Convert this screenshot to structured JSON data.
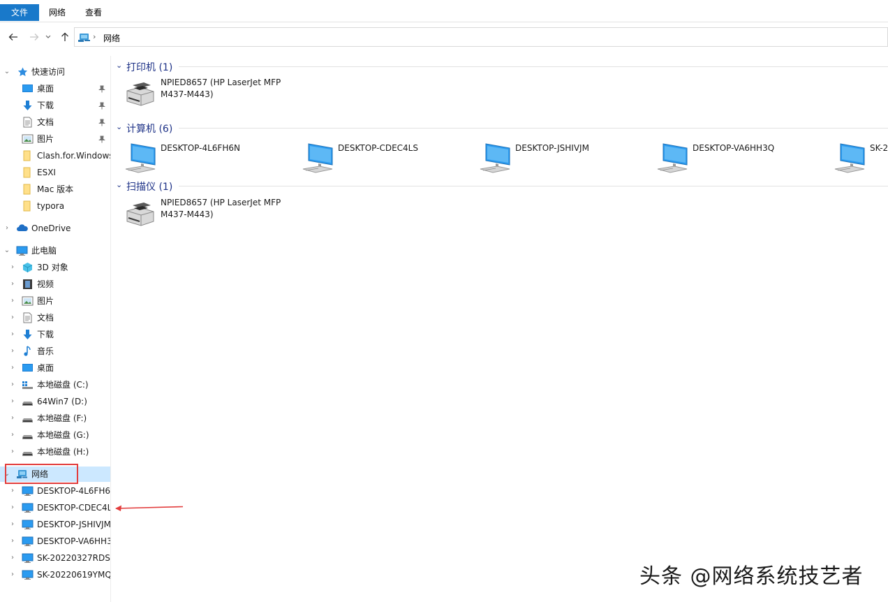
{
  "ribbon": {
    "tabs": [
      "文件",
      "网络",
      "查看"
    ]
  },
  "address": {
    "path": "网络"
  },
  "nav": {
    "quick_access": {
      "label": "快速访问",
      "items": [
        {
          "label": "桌面",
          "icon": "desktop-icon",
          "pinned": true
        },
        {
          "label": "下载",
          "icon": "download-icon",
          "pinned": true
        },
        {
          "label": "文档",
          "icon": "document-icon",
          "pinned": true
        },
        {
          "label": "图片",
          "icon": "picture-icon",
          "pinned": true
        },
        {
          "label": "Clash.for.Windows",
          "icon": "folder-icon",
          "pinned": false
        },
        {
          "label": "ESXI",
          "icon": "folder-icon",
          "pinned": false
        },
        {
          "label": "Mac 版本",
          "icon": "folder-icon",
          "pinned": false
        },
        {
          "label": "typora",
          "icon": "folder-icon",
          "pinned": false
        }
      ]
    },
    "onedrive": {
      "label": "OneDrive"
    },
    "this_pc": {
      "label": "此电脑",
      "items": [
        {
          "label": "3D 对象",
          "icon": "3d-objects-icon"
        },
        {
          "label": "视频",
          "icon": "video-icon"
        },
        {
          "label": "图片",
          "icon": "picture-icon"
        },
        {
          "label": "文档",
          "icon": "document-icon"
        },
        {
          "label": "下载",
          "icon": "download-icon"
        },
        {
          "label": "音乐",
          "icon": "music-icon"
        },
        {
          "label": "桌面",
          "icon": "desktop-icon"
        },
        {
          "label": "本地磁盘 (C:)",
          "icon": "system-drive-icon"
        },
        {
          "label": "64Win7  (D:)",
          "icon": "drive-icon"
        },
        {
          "label": "本地磁盘 (F:)",
          "icon": "drive-icon"
        },
        {
          "label": "本地磁盘 (G:)",
          "icon": "drive-icon"
        },
        {
          "label": "本地磁盘 (H:)",
          "icon": "drive-icon"
        }
      ]
    },
    "network": {
      "label": "网络",
      "items": [
        {
          "label": "DESKTOP-4L6FH6"
        },
        {
          "label": "DESKTOP-CDEC4L"
        },
        {
          "label": "DESKTOP-JSHIVJM"
        },
        {
          "label": "DESKTOP-VA6HH3"
        },
        {
          "label": "SK-20220327RDS"
        },
        {
          "label": "SK-20220619YMQ"
        }
      ]
    }
  },
  "content": {
    "groups": [
      {
        "title": "打印机 (1)",
        "items": [
          {
            "line1": "NPIED8657 (HP LaserJet MFP",
            "line2": "M437-M443)"
          }
        ]
      },
      {
        "title": "计算机 (6)",
        "items": [
          {
            "line1": "DESKTOP-4L6FH6N"
          },
          {
            "line1": "DESKTOP-CDEC4LS"
          },
          {
            "line1": "DESKTOP-JSHIVJM"
          },
          {
            "line1": "DESKTOP-VA6HH3Q"
          },
          {
            "line1": "SK-2"
          }
        ]
      },
      {
        "title": "扫描仪 (1)",
        "items": [
          {
            "line1": "NPIED8657 (HP LaserJet MFP",
            "line2": "M437-M443)"
          }
        ]
      }
    ]
  },
  "watermark": {
    "text": "头条 @网络系统技艺者"
  },
  "colors": {
    "accent": "#1979ca",
    "group_title": "#1e3287",
    "selection": "#cce8ff",
    "annotation_red": "#e23c3c"
  }
}
